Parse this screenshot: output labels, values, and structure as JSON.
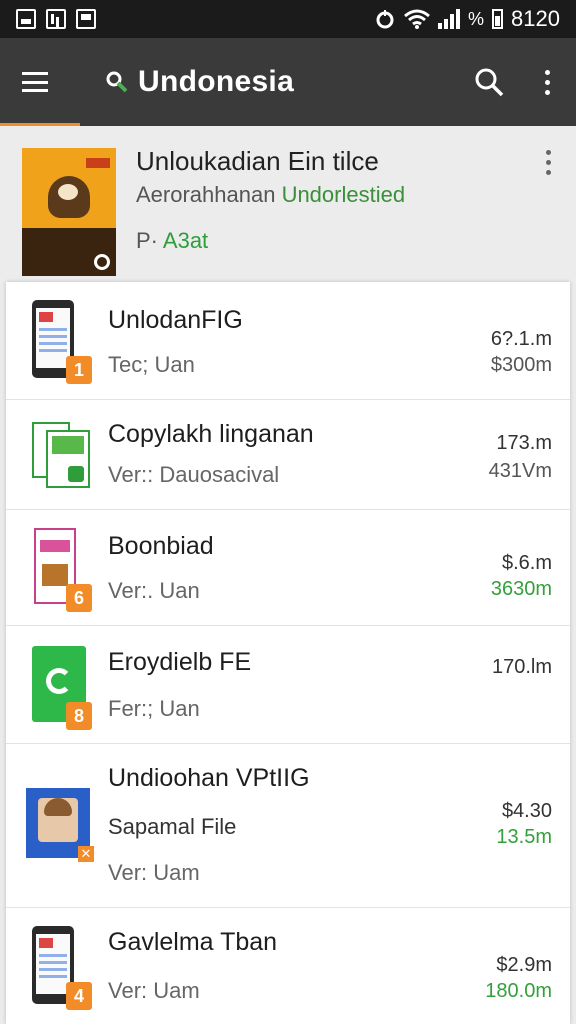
{
  "status_bar": {
    "time": "8120"
  },
  "app_bar": {
    "title": "Undonesia"
  },
  "featured": {
    "title": "Unloukadian Ein tilce",
    "subtitle_prefix": "Aerorahhanan ",
    "subtitle_highlight": "Undorlestied",
    "tag_prefix": "P· ",
    "tag_price": "A3at"
  },
  "items": [
    {
      "name": "UnlodanFIG",
      "version": "Tec; Uan",
      "size": "6?.1.m",
      "price": "$300m",
      "badge": "1"
    },
    {
      "name": "Copylakh linganan",
      "version": "Ver:: Dauosacival",
      "size": "173.m",
      "price": "431Vm"
    },
    {
      "name": "Boonbiad",
      "version": "Ver:. Uan",
      "size": "$.6.m",
      "price": "3630m",
      "badge": "6"
    },
    {
      "name": "Eroydielb FE",
      "version": "Fer:; Uan",
      "size": "170.lm",
      "badge": "8"
    },
    {
      "name": "Undioohan VPtIIG",
      "extra": "Sapamal File",
      "version": "Ver: Uam",
      "size": "$4.30",
      "price": "13.5m"
    },
    {
      "name": "Gavlelma Tban",
      "version": "Ver: Uam",
      "size": "$2.9m",
      "price": "180.0m",
      "badge": "4"
    }
  ]
}
